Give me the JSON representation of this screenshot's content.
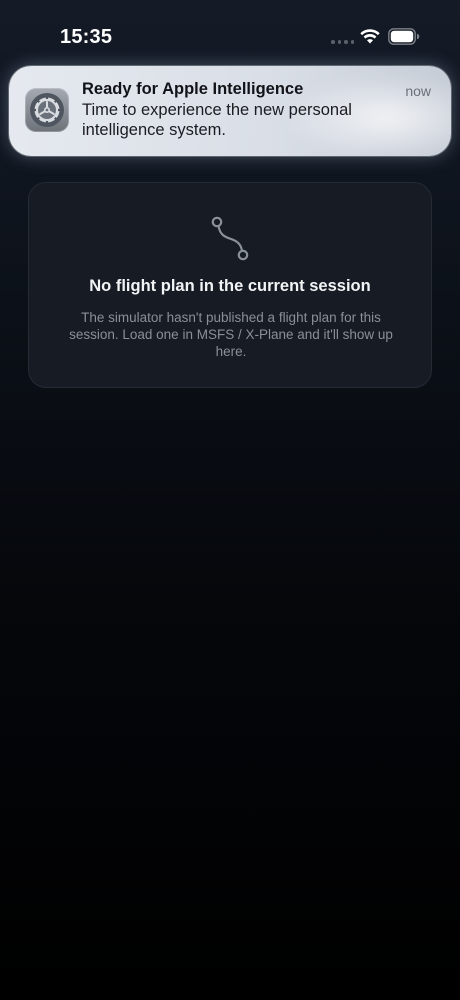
{
  "status_bar": {
    "time": "15:35",
    "icons": [
      "signal-dots-icon",
      "wifi-icon",
      "battery-icon"
    ]
  },
  "notification": {
    "app_icon": "settings-gear-icon",
    "title": "Ready for Apple Intelligence",
    "time": "now",
    "body": "Time to experience the new personal intelligence system."
  },
  "empty_state": {
    "icon": "route-icon",
    "title": "No flight plan in the current session",
    "description": "The simulator hasn't published a flight plan for this session. Load one in MSFS / X-Plane and it'll show up here."
  },
  "colors": {
    "background_top": "#141b27",
    "background_bottom": "#000000",
    "card_background": "#161b24",
    "card_border": "#252b35",
    "title_text": "#f2f3f5",
    "secondary_text": "#8a8f98",
    "icon_gray": "#8b919a"
  }
}
